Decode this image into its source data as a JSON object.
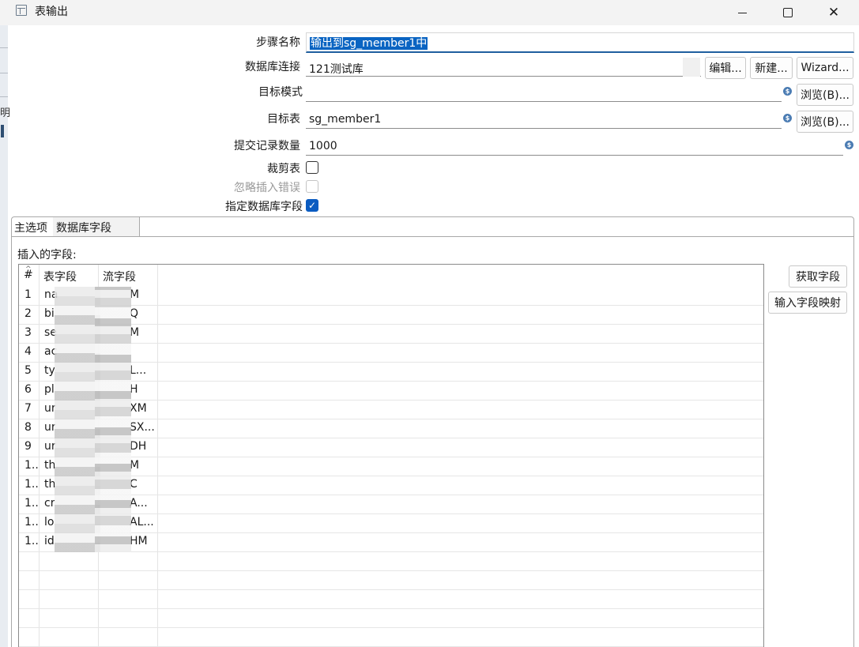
{
  "window": {
    "title": "表输出"
  },
  "form": {
    "step_name": {
      "label": "步骤名称",
      "value": "输出到sg_member1中"
    },
    "db_connection": {
      "label": "数据库连接",
      "value": "121测试库",
      "edit_button": "编辑...",
      "new_button": "新建...",
      "wizard_button": "Wizard..."
    },
    "target_schema": {
      "label": "目标模式",
      "value": "",
      "browse_button": "浏览(B)..."
    },
    "target_table": {
      "label": "目标表",
      "value": "sg_member1",
      "browse_button": "浏览(B)..."
    },
    "commit_size": {
      "label": "提交记录数量",
      "value": "1000"
    },
    "truncate_table": {
      "label": "裁剪表",
      "checked": false
    },
    "ignore_insert_errors": {
      "label": "忽略插入错误",
      "checked": false,
      "enabled": false
    },
    "specify_db_fields": {
      "label": "指定数据库字段",
      "checked": true,
      "check_glyph": "✓"
    }
  },
  "tabs": [
    {
      "label": "主选项"
    },
    {
      "label": "数据库字段"
    }
  ],
  "fields_panel": {
    "label": "插入的字段:",
    "get_fields_button": "获取字段",
    "input_mapping_button": "输入字段映射",
    "columns": {
      "index": "#",
      "table_field": "表字段",
      "stream_field": "流字段"
    },
    "rows": [
      {
        "index": "1",
        "table_field": "na",
        "stream_field": "M"
      },
      {
        "index": "2",
        "table_field": "bi",
        "stream_field": "Q"
      },
      {
        "index": "3",
        "table_field": "se",
        "stream_field": "M"
      },
      {
        "index": "4",
        "table_field": "ac",
        "stream_field": ""
      },
      {
        "index": "5",
        "table_field": "ty",
        "stream_field": "L..."
      },
      {
        "index": "6",
        "table_field": "pl",
        "stream_field": "H"
      },
      {
        "index": "7",
        "table_field": "ur",
        "stream_field": "XM"
      },
      {
        "index": "8",
        "table_field": "ur",
        "stream_field": "SX..."
      },
      {
        "index": "9",
        "table_field": "ur",
        "stream_field": "DH"
      },
      {
        "index": "1..",
        "table_field": "th",
        "stream_field": "M"
      },
      {
        "index": "1..",
        "table_field": "th",
        "stream_field": "C"
      },
      {
        "index": "1..",
        "table_field": "cr",
        "stream_field": "A..."
      },
      {
        "index": "1..",
        "table_field": "lo",
        "stream_field": "AL..."
      },
      {
        "index": "1..",
        "table_field": "id",
        "stream_field": "HM"
      }
    ]
  },
  "icons": {
    "variable": "$",
    "close": "✕",
    "sort": "^"
  },
  "left_strip_text": "明",
  "colors": {
    "accent": "#0b5cc1",
    "selection": "#0a64c2"
  }
}
